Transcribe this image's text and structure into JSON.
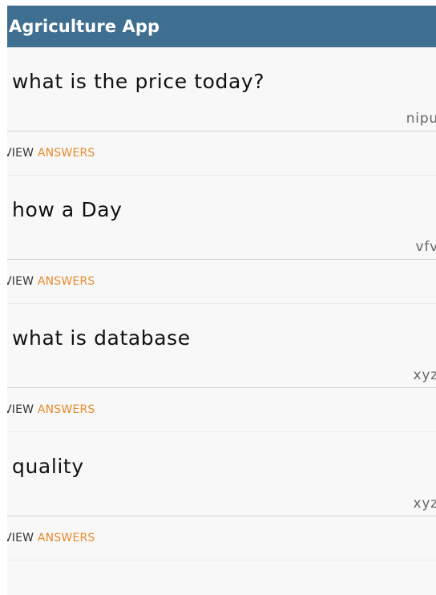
{
  "app_bar": {
    "title": "Agriculture App"
  },
  "questions": [
    {
      "text": "what is the price today?",
      "author": "nipu",
      "action_prefix": "VIEW ",
      "action_suffix": "ANSWERS"
    },
    {
      "text": "how a Day",
      "author": "vfv",
      "action_prefix": "VIEW ",
      "action_suffix": "ANSWERS"
    },
    {
      "text": "what is database",
      "author": "xyz",
      "action_prefix": "VIEW ",
      "action_suffix": "ANSWERS"
    },
    {
      "text": "quality",
      "author": "xyz",
      "action_prefix": "VIEW ",
      "action_suffix": "ANSWERS"
    }
  ],
  "colors": {
    "app_bar": "#3f6f90",
    "accent": "#e8892a",
    "background": "#f8f8f8"
  }
}
